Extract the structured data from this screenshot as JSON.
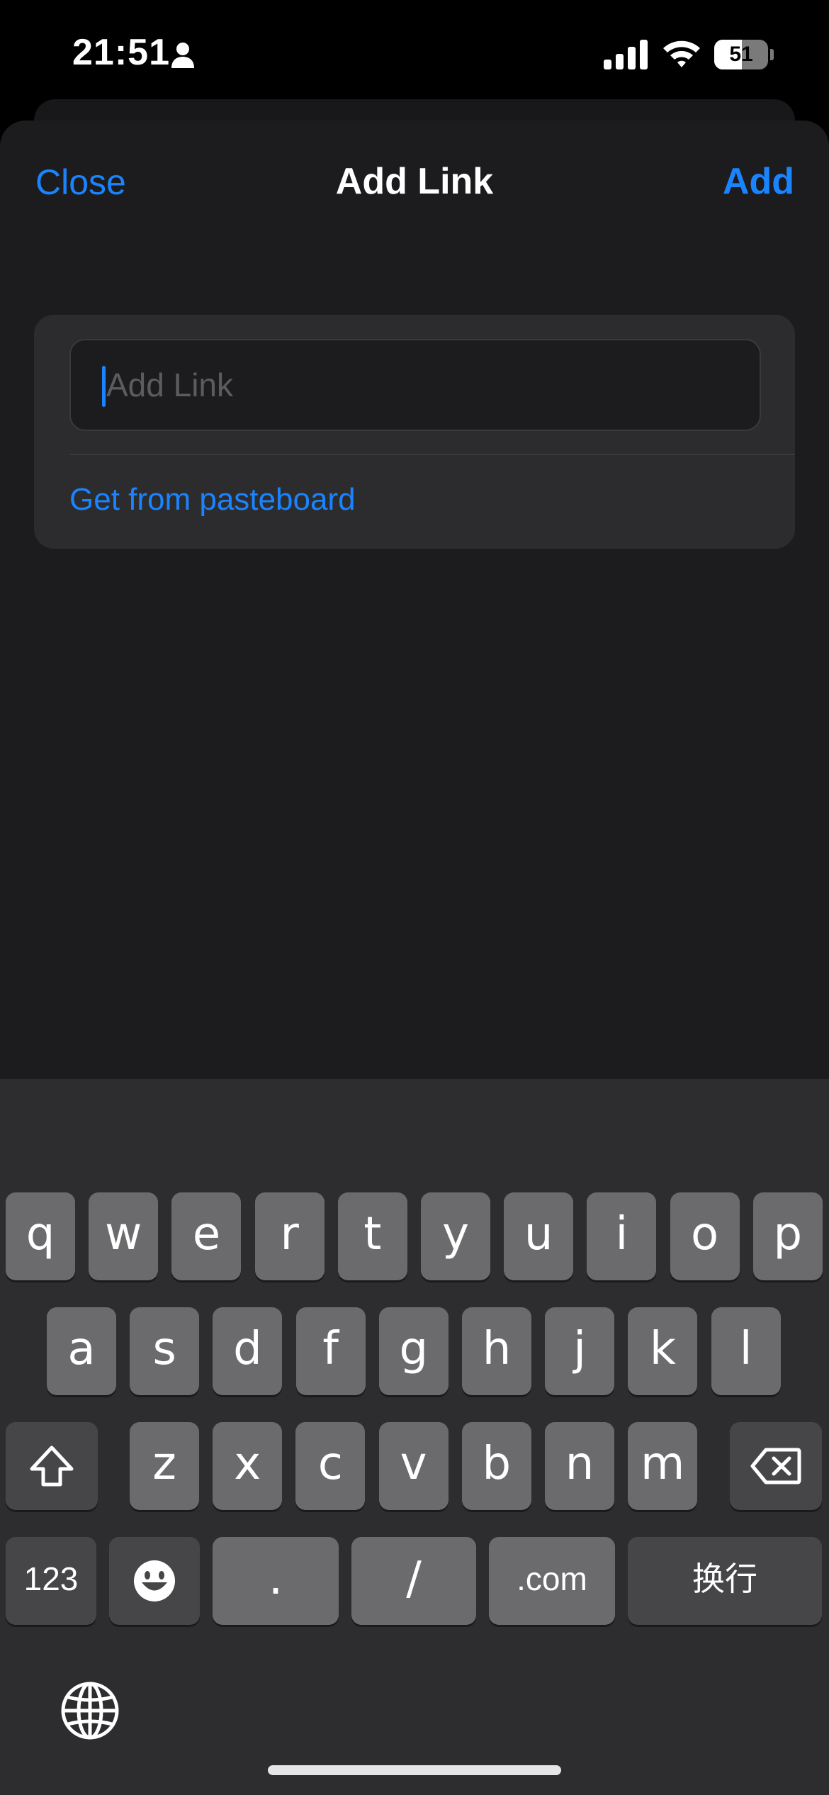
{
  "status_bar": {
    "time": "21:51",
    "battery_level": "51",
    "battery_fraction": 0.51,
    "icons": [
      "person-icon",
      "cellular-signal-icon",
      "wifi-icon",
      "battery-icon"
    ]
  },
  "nav": {
    "close_label": "Close",
    "title": "Add Link",
    "add_label": "Add"
  },
  "form": {
    "link_value": "",
    "link_placeholder": "Add Link",
    "pasteboard_label": "Get from pasteboard"
  },
  "keyboard": {
    "row1": [
      "q",
      "w",
      "e",
      "r",
      "t",
      "y",
      "u",
      "i",
      "o",
      "p"
    ],
    "row2": [
      "a",
      "s",
      "d",
      "f",
      "g",
      "h",
      "j",
      "k",
      "l"
    ],
    "row3": [
      "z",
      "x",
      "c",
      "v",
      "b",
      "n",
      "m"
    ],
    "numbers_label": "123",
    "period_label": ".",
    "slash_label": "/",
    "dotcom_label": ".com",
    "return_label": "换行",
    "icons": [
      "shift-icon",
      "delete-icon",
      "emoji-icon",
      "globe-icon"
    ]
  },
  "colors": {
    "accent": "#1a84ff",
    "sheet_background": "#1c1c1e",
    "card_background": "#2c2c2e",
    "keyboard_background": "#2d2d2f",
    "key_light": "#6b6b6d",
    "key_dark": "#464648"
  }
}
